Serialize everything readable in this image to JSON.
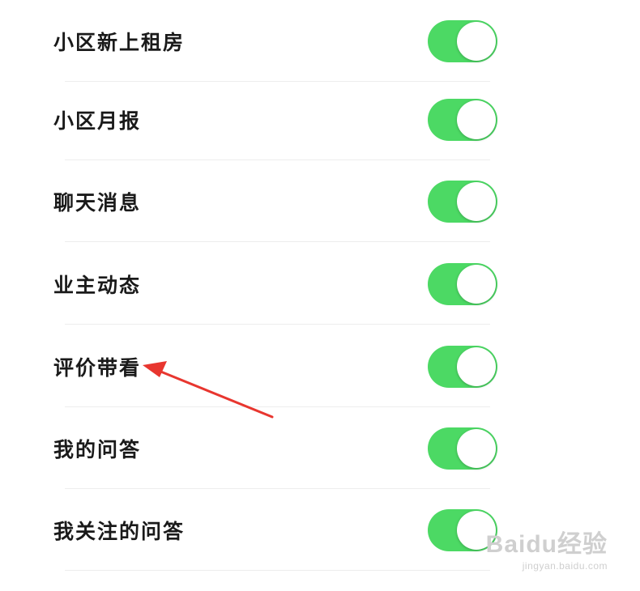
{
  "settings": [
    {
      "label": "小区新上租房",
      "enabled": true
    },
    {
      "label": "小区月报",
      "enabled": true
    },
    {
      "label": "聊天消息",
      "enabled": true
    },
    {
      "label": "业主动态",
      "enabled": true
    },
    {
      "label": "评价带看",
      "enabled": true
    },
    {
      "label": "我的问答",
      "enabled": true
    },
    {
      "label": "我关注的问答",
      "enabled": true
    }
  ],
  "colors": {
    "toggle_on": "#4cd964",
    "arrow": "#e8362f",
    "divider": "#ededed"
  },
  "annotation": {
    "target_label": "评价带看",
    "icon": "red-arrow-icon"
  },
  "watermark": {
    "brand": "Baidu经验",
    "url": "jingyan.baidu.com"
  }
}
